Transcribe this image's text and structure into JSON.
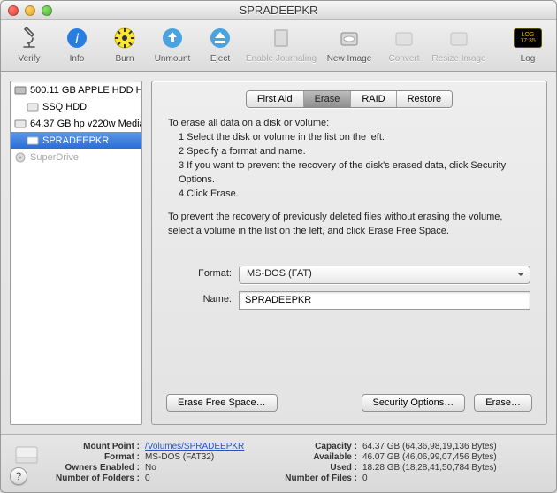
{
  "window_title": "SPRADEEPKR",
  "toolbar": {
    "verify": "Verify",
    "info": "Info",
    "burn": "Burn",
    "unmount": "Unmount",
    "eject": "Eject",
    "enable_journaling": "Enable Journaling",
    "new_image": "New Image",
    "convert": "Convert",
    "resize_image": "Resize Image",
    "log": "Log"
  },
  "sidebar": {
    "items": [
      {
        "label": "500.11 GB APPLE HDD H…",
        "kind": "root"
      },
      {
        "label": "SSQ HDD",
        "kind": "vol"
      },
      {
        "label": "64.37 GB hp v220w Media",
        "kind": "root"
      },
      {
        "label": "SPRADEEPKR",
        "kind": "vol",
        "selected": true
      },
      {
        "label": "SuperDrive",
        "kind": "root",
        "dim": true
      }
    ]
  },
  "tabs": {
    "firstaid": "First Aid",
    "erase": "Erase",
    "raid": "RAID",
    "restore": "Restore"
  },
  "instructions": {
    "intro": "To erase all data on a disk or volume:",
    "s1": "1    Select the disk or volume in the list on the left.",
    "s2": "2    Specify a format and name.",
    "s3": "3    If you want to prevent the recovery of the disk's erased data, click Security Options.",
    "s4": "4    Click Erase.",
    "para2": "To prevent the recovery of previously deleted files without erasing the volume, select a volume in the list on the left, and click Erase Free Space."
  },
  "form": {
    "format_label": "Format:",
    "format_value": "MS-DOS (FAT)",
    "name_label": "Name:",
    "name_value": "SPRADEEPKR"
  },
  "buttons": {
    "erase_free_space": "Erase Free Space…",
    "security_options": "Security Options…",
    "erase": "Erase…"
  },
  "footer": {
    "mount_point_k": "Mount Point :",
    "mount_point_v": "/Volumes/SPRADEEPKR",
    "format_k": "Format :",
    "format_v": "MS-DOS (FAT32)",
    "owners_k": "Owners Enabled :",
    "owners_v": "No",
    "folders_k": "Number of Folders :",
    "folders_v": "0",
    "capacity_k": "Capacity :",
    "capacity_v": "64.37 GB (64,36,98,19,136 Bytes)",
    "available_k": "Available :",
    "available_v": "46.07 GB (46,06,99,07,456 Bytes)",
    "used_k": "Used :",
    "used_v": "18.28 GB (18,28,41,50,784 Bytes)",
    "files_k": "Number of Files :",
    "files_v": "0"
  }
}
